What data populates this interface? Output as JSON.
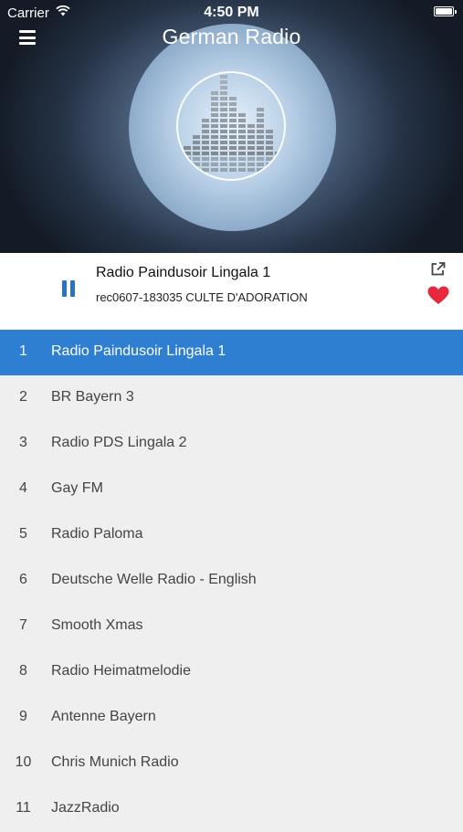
{
  "status_bar": {
    "carrier": "Carrier",
    "time": "4:50 PM"
  },
  "header": {
    "title": "German Radio"
  },
  "now_playing": {
    "station": "Radio Paindusoir Lingala 1",
    "track": "rec0607-183035 CULTE D'ADORATION",
    "state": "playing",
    "favorite": true
  },
  "icons": {
    "menu": "menu-icon",
    "pause": "pause-icon",
    "share": "share-icon",
    "favorite": "heart-icon",
    "wifi": "wifi-icon",
    "battery": "battery-icon"
  },
  "colors": {
    "accent": "#2e7fd2",
    "pause": "#2a72c2",
    "heart": "#e8283d"
  },
  "stations": [
    {
      "num": "1",
      "name": "Radio Paindusoir Lingala 1",
      "selected": true
    },
    {
      "num": "2",
      "name": "BR Bayern 3"
    },
    {
      "num": "3",
      "name": "Radio PDS Lingala 2"
    },
    {
      "num": "4",
      "name": "Gay FM"
    },
    {
      "num": "5",
      "name": "Radio Paloma"
    },
    {
      "num": "6",
      "name": "Deutsche Welle Radio - English"
    },
    {
      "num": "7",
      "name": "Smooth Xmas"
    },
    {
      "num": "8",
      "name": "Radio Heimatmelodie"
    },
    {
      "num": "9",
      "name": "Antenne Bayern"
    },
    {
      "num": "10",
      "name": "Chris Munich Radio"
    },
    {
      "num": "11",
      "name": "JazzRadio"
    }
  ]
}
